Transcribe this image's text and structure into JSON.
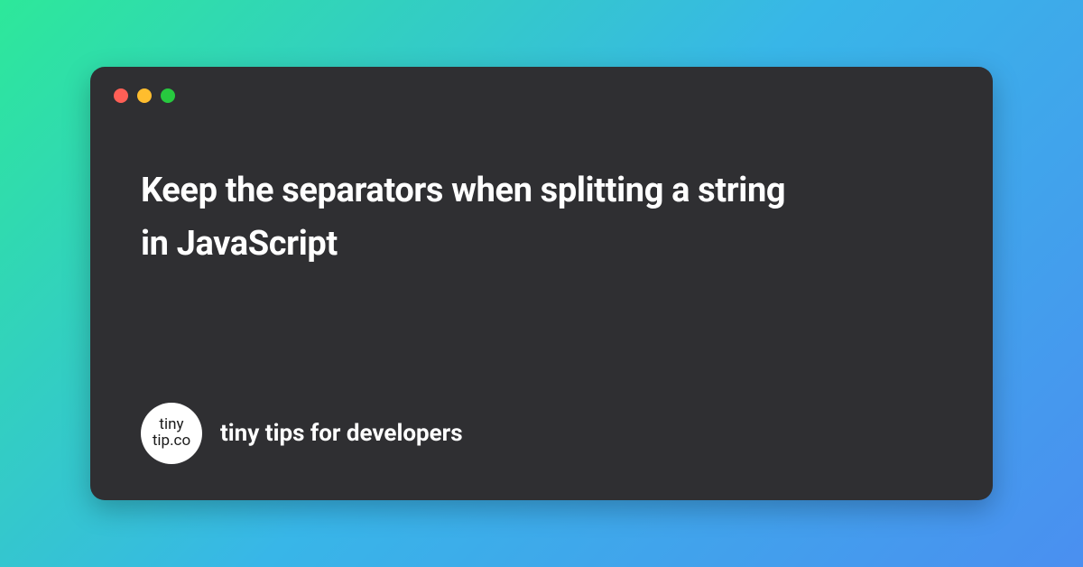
{
  "window": {
    "background_color": "#2f2f32",
    "traffic_lights": {
      "red": "#ff5f56",
      "yellow": "#ffbd2e",
      "green": "#27c93f"
    }
  },
  "content": {
    "title": "Keep the separators when splitting a string in JavaScript"
  },
  "footer": {
    "logo": {
      "line1": "tiny",
      "line2": "tip.co"
    },
    "tagline": "tiny tips for developers"
  },
  "gradient": {
    "start": "#2de89a",
    "mid": "#38b6e8",
    "end": "#4a8ff0"
  }
}
